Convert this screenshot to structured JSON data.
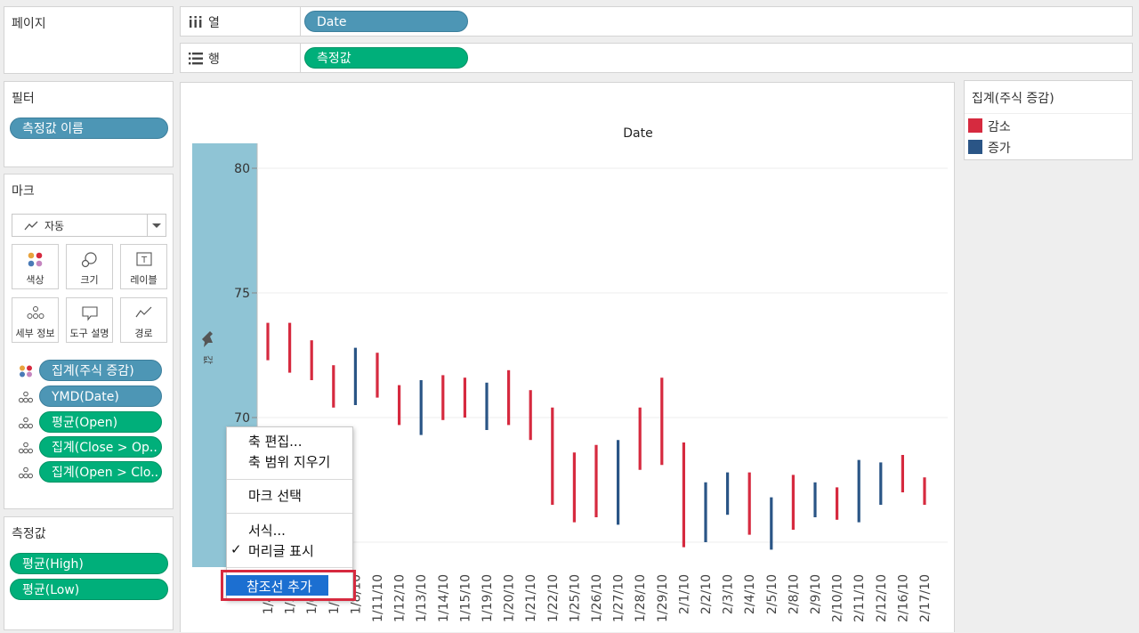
{
  "left_panel": {
    "pages": {
      "title": "페이지"
    },
    "filters": {
      "title": "필터",
      "pills": [
        "측정값 이름"
      ]
    },
    "marks": {
      "title": "마크",
      "mark_type": "자동",
      "buttons": [
        {
          "label": "색상",
          "icon": "color-icon"
        },
        {
          "label": "크기",
          "icon": "size-icon"
        },
        {
          "label": "레이블",
          "icon": "label-icon"
        },
        {
          "label": "세부 정보",
          "icon": "detail-icon"
        },
        {
          "label": "도구 설명",
          "icon": "tooltip-icon"
        },
        {
          "label": "경로",
          "icon": "path-icon"
        }
      ],
      "cards": [
        {
          "label": "집계(주식 증감)",
          "color": "blue",
          "icon": "color-icon"
        },
        {
          "label": "YMD(Date)",
          "color": "blue",
          "icon": "detail-icon"
        },
        {
          "label": "평균(Open)",
          "color": "green",
          "icon": "detail-icon"
        },
        {
          "label": "집계(Close > Op..",
          "color": "green",
          "icon": "detail-icon"
        },
        {
          "label": "집계(Open > Clo..",
          "color": "green",
          "icon": "detail-icon"
        }
      ]
    },
    "measure_values": {
      "title": "측정값",
      "pills": [
        "평균(High)",
        "평균(Low)"
      ]
    }
  },
  "shelves": {
    "columns": {
      "label": "열",
      "icon": "columns-icon",
      "pill": "Date"
    },
    "rows": {
      "label": "행",
      "icon": "rows-icon",
      "pill": "측정값"
    }
  },
  "legend": {
    "title": "집계(주식 증감)",
    "items": [
      {
        "label": "감소",
        "color": "#d62a3f"
      },
      {
        "label": "증가",
        "color": "#2a5586"
      }
    ]
  },
  "colors": {
    "decrease": "#d62a3f",
    "increase": "#2a5586",
    "blue_pill": "#4d96b5",
    "green_pill": "#00af7a",
    "axis_highlight": "#8fc4d5",
    "menu_highlight": "#1c6fd1",
    "menu_outline": "#d62a3f"
  },
  "context_menu": {
    "items": [
      {
        "label": "축 편집..."
      },
      {
        "label": "축 범위 지우기"
      },
      {
        "label": "마크 선택"
      },
      {
        "label": "서식..."
      },
      {
        "label": "머리글 표시",
        "checked": true
      },
      {
        "label": "참조선 추가",
        "highlighted": true
      }
    ]
  },
  "chart_data": {
    "type": "candlestick-range",
    "title": "Date",
    "ylabel": "값",
    "ylim": [
      64,
      81
    ],
    "yticks": [
      80,
      75,
      70
    ],
    "categories": [
      "1/4/10",
      "1/5/10",
      "1/6/10",
      "1/7/10",
      "1/8/10",
      "1/11/10",
      "1/12/10",
      "1/13/10",
      "1/14/10",
      "1/15/10",
      "1/19/10",
      "1/20/10",
      "1/21/10",
      "1/22/10",
      "1/25/10",
      "1/26/10",
      "1/27/10",
      "1/28/10",
      "1/29/10",
      "2/1/10",
      "2/2/10",
      "2/3/10",
      "2/4/10",
      "2/5/10",
      "2/8/10",
      "2/9/10",
      "2/10/10",
      "2/11/10",
      "2/12/10",
      "2/16/10",
      "2/17/10"
    ],
    "series": [
      {
        "name": "High",
        "values": [
          73.8,
          73.8,
          73.1,
          72.1,
          72.8,
          72.6,
          71.3,
          71.5,
          71.7,
          71.6,
          71.4,
          71.9,
          71.1,
          70.4,
          68.6,
          68.9,
          69.1,
          70.4,
          71.6,
          69.0,
          67.4,
          67.8,
          67.8,
          66.8,
          67.7,
          67.4,
          67.2,
          68.3,
          68.2,
          68.5,
          67.6
        ]
      },
      {
        "name": "Low",
        "values": [
          72.3,
          71.8,
          71.5,
          70.4,
          70.5,
          70.8,
          69.7,
          69.3,
          69.9,
          70.0,
          69.5,
          69.7,
          69.1,
          66.5,
          65.8,
          66.0,
          65.7,
          67.9,
          68.1,
          64.8,
          65.0,
          66.1,
          65.3,
          64.7,
          65.5,
          66.0,
          65.9,
          65.8,
          66.5,
          67.0,
          66.5
        ]
      },
      {
        "name": "집계(주식 증감)",
        "values": [
          "감소",
          "감소",
          "감소",
          "감소",
          "증가",
          "감소",
          "감소",
          "증가",
          "감소",
          "감소",
          "증가",
          "감소",
          "감소",
          "감소",
          "감소",
          "감소",
          "증가",
          "감소",
          "감소",
          "감소",
          "증가",
          "증가",
          "감소",
          "증가",
          "감소",
          "증가",
          "감소",
          "증가",
          "증가",
          "감소",
          "감소"
        ]
      }
    ]
  }
}
